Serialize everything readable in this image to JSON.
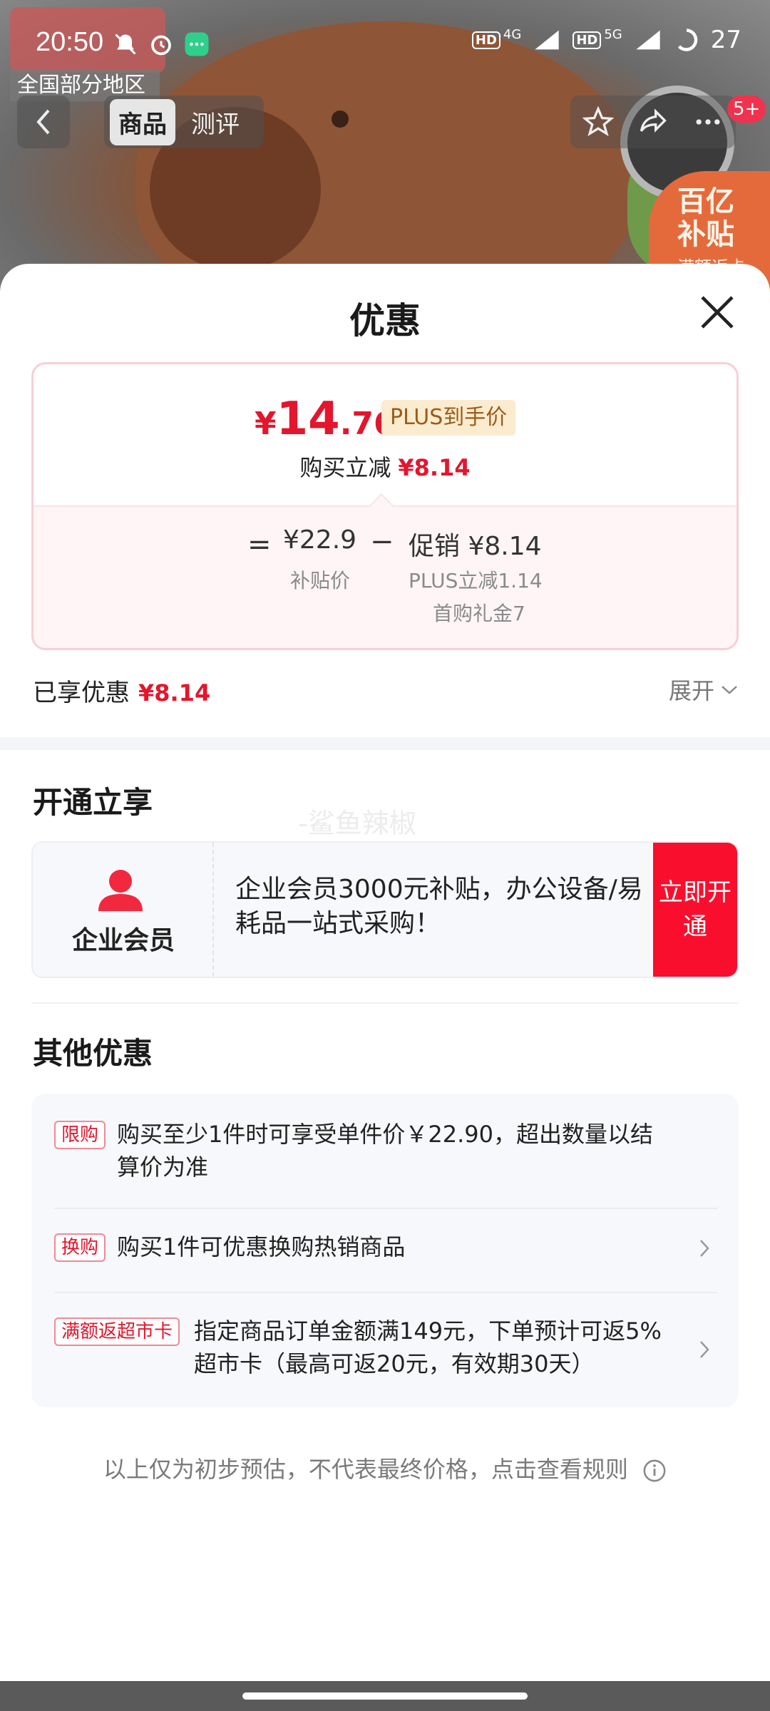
{
  "status_bar": {
    "time": "20:50",
    "battery": "27",
    "net1": "4G",
    "net2": "5G"
  },
  "hero": {
    "region_label": "全国部分地区",
    "tabs": [
      "商品",
      "测评"
    ],
    "cart_count": "5+",
    "subsidy_line1": "百亿",
    "subsidy_line2": "补贴",
    "subsidy_small": "满额返卡"
  },
  "sheet": {
    "title": "优惠",
    "price": {
      "currency": "¥",
      "integer": "14",
      "decimal": ".76",
      "tag": "PLUS到手价",
      "reduce_label": "购买立减",
      "reduce_value": "¥8.14",
      "eq": "=",
      "base_value": "¥22.9",
      "base_label": "补贴价",
      "minus": "−",
      "promo_value": "促销 ¥8.14",
      "promo_sub1": "PLUS立减1.14",
      "promo_sub2": "首购礼金7"
    },
    "enjoyed_label": "已享优惠",
    "enjoyed_value": "¥8.14",
    "expand_label": "展开",
    "open_section_title": "开通立享",
    "watermark": "-鲨鱼辣椒",
    "member": {
      "name": "企业会员",
      "desc": "企业会员3000元补贴，办公设备/易耗品一站式采购！",
      "button": "立即开通"
    },
    "other_section_title": "其他优惠",
    "offers": [
      {
        "tag": "限购",
        "text": "购买至少1件时可享受单件价￥22.90，超出数量以结算价为准"
      },
      {
        "tag": "换购",
        "text": "购买1件可优惠换购热销商品"
      },
      {
        "tag": "满额返超市卡",
        "text": "指定商品订单金额满149元，下单预计可返5%超市卡（最高可返20元，有效期30天）"
      }
    ],
    "disclaimer": "以上仅为初步预估，不代表最终价格，点击查看规则"
  },
  "colors": {
    "accent_red": "#e3162d",
    "button_red": "#f90f2d",
    "plus_gold": "#9b5b1a"
  }
}
